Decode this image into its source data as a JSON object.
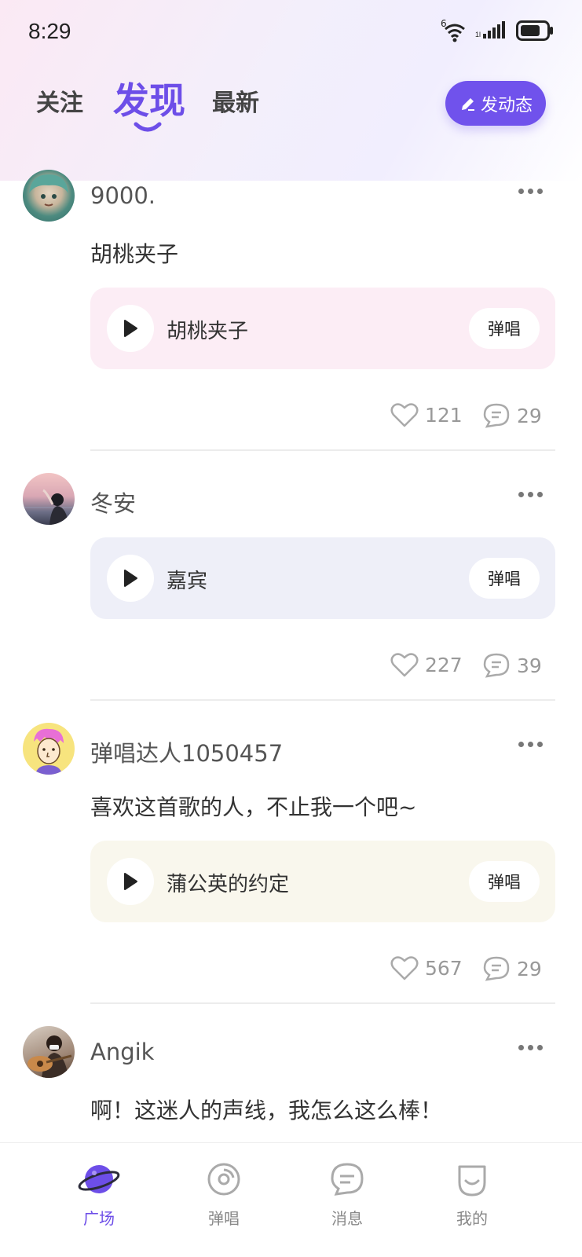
{
  "status_bar": {
    "time": "8:29",
    "network_label": "6"
  },
  "tabs": [
    {
      "label": "关注"
    },
    {
      "label": "发现",
      "active": true
    },
    {
      "label": "最新"
    }
  ],
  "post_button": {
    "label": "发动态"
  },
  "posts": [
    {
      "username": "9000.",
      "text": "胡桃夹子",
      "song": {
        "title": "胡桃夹子",
        "sing_label": "弹唱",
        "card_color": "#fcedf5"
      },
      "likes": "121",
      "comments": "29"
    },
    {
      "username": "冬安",
      "text": "",
      "song": {
        "title": "嘉宾",
        "sing_label": "弹唱",
        "card_color": "#eeeff8"
      },
      "likes": "227",
      "comments": "39"
    },
    {
      "username": "弹唱达人1050457",
      "text": "喜欢这首歌的人，不止我一个吧~",
      "song": {
        "title": "蒲公英的约定",
        "sing_label": "弹唱",
        "card_color": "#f9f7ed"
      },
      "likes": "567",
      "comments": "29"
    },
    {
      "username": "Angik",
      "text": "啊！这迷人的声线，我怎么这么棒！"
    }
  ],
  "bottom_nav": [
    {
      "label": "广场",
      "icon": "planet-icon",
      "active": true
    },
    {
      "label": "弹唱",
      "icon": "disc-icon"
    },
    {
      "label": "消息",
      "icon": "chat-icon"
    },
    {
      "label": "我的",
      "icon": "smile-icon"
    }
  ],
  "colors": {
    "accent": "#6d4ee8",
    "button": "#7052ec"
  }
}
